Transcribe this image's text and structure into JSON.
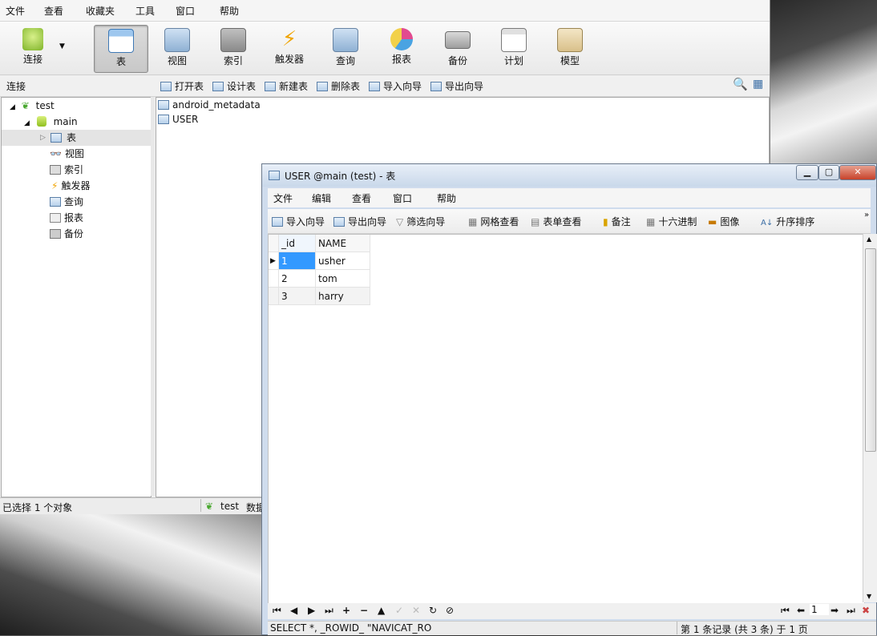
{
  "main_menu": [
    "文件",
    "查看",
    "收藏夹",
    "工具",
    "窗口",
    "帮助"
  ],
  "ribbon": {
    "connect_label": "连接",
    "items": [
      "表",
      "视图",
      "索引",
      "触发器",
      "查询",
      "报表",
      "备份",
      "计划",
      "模型"
    ],
    "active": "表"
  },
  "subbar": {
    "panel_label": "连接",
    "buttons": [
      "打开表",
      "设计表",
      "新建表",
      "删除表",
      "导入向导",
      "导出向导"
    ]
  },
  "tree": {
    "connection": "test",
    "database": "main",
    "nodes": [
      "表",
      "视图",
      "索引",
      "触发器",
      "查询",
      "报表",
      "备份"
    ]
  },
  "objects": [
    "android_metadata",
    "USER"
  ],
  "status": {
    "selected": "已选择 1 个对象",
    "connection": "test",
    "extra": "数据"
  },
  "table_window": {
    "title": "USER @main (test) - 表",
    "menu": [
      "文件",
      "编辑",
      "查看",
      "窗口",
      "帮助"
    ],
    "toolbar": [
      "导入向导",
      "导出向导",
      "筛选向导",
      "网格查看",
      "表单查看",
      "备注",
      "十六进制",
      "图像",
      "升序排序"
    ],
    "columns": [
      "_id",
      "NAME"
    ],
    "rows": [
      [
        "1",
        "usher"
      ],
      [
        "2",
        "tom"
      ],
      [
        "3",
        "harry"
      ]
    ],
    "page_value": "1",
    "sql": "SELECT *, _ROWID_ \"NAVICAT_RO",
    "record_info": "第 1 条记录 (共 3 条) 于 1 页"
  }
}
